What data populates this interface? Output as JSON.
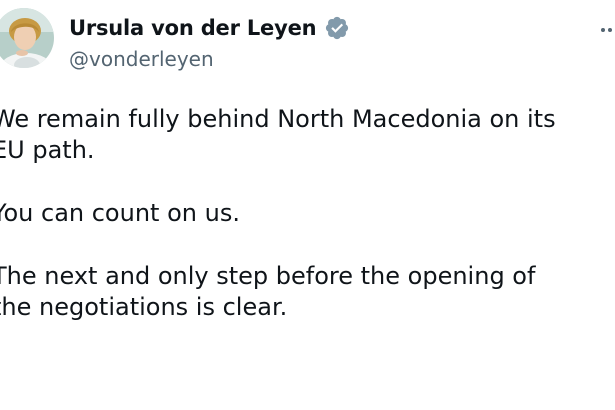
{
  "author": {
    "display_name": "Ursula von der Leyen",
    "handle": "@vonderleyen",
    "verified": true
  },
  "colors": {
    "text": "#0f1419",
    "secondary_text": "#536471",
    "verified_badge": "#829aab",
    "background": "#ffffff"
  },
  "icons": {
    "verified": "verified-badge-icon",
    "more": "more-options-icon"
  },
  "tweet": {
    "paragraphs": [
      "We remain fully behind North Macedonia on its\nEU path.",
      "You can count on us.",
      "The next and only step before the opening of\nthe negotiations is clear."
    ]
  }
}
